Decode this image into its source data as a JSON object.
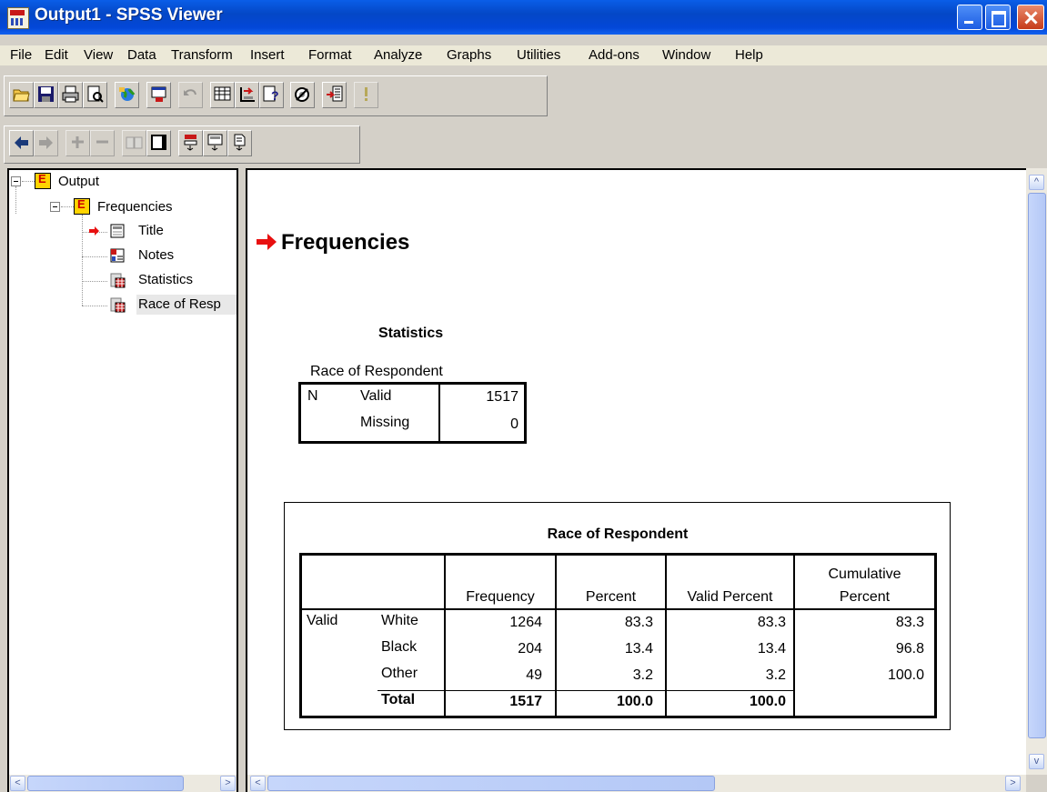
{
  "window": {
    "title": "Output1 - SPSS Viewer"
  },
  "menu": [
    "File",
    "Edit",
    "View",
    "Data",
    "Transform",
    "Insert",
    "Format",
    "Analyze",
    "Graphs",
    "Utilities",
    "Add-ons",
    "Window",
    "Help"
  ],
  "toolbar1": [
    "open-icon",
    "save-icon",
    "print-icon",
    "print-preview-icon",
    "export-icon",
    "dialog-recall-icon",
    "undo-icon",
    "go-to-data-icon",
    "go-to-case-icon",
    "variables-icon",
    "use-sets-icon",
    "designate-window-icon",
    "run-icon"
  ],
  "toolbar2": [
    "promote-icon",
    "demote-icon",
    "expand-icon",
    "collapse-icon",
    "show-icon",
    "hide-icon",
    "insert-heading-icon",
    "insert-title-icon",
    "insert-text-icon"
  ],
  "tree": {
    "root": "Output",
    "child": "Frequencies",
    "items": [
      "Title",
      "Notes",
      "Statistics",
      "Race of Resp"
    ]
  },
  "output": {
    "heading": "Frequencies",
    "statistics": {
      "title": "Statistics",
      "subtitle": "Race of Respondent",
      "n_label": "N",
      "valid_label": "Valid",
      "valid_value": "1517",
      "missing_label": "Missing",
      "missing_value": "0"
    },
    "race_table": {
      "title": "Race of Respondent",
      "headers": [
        "Frequency",
        "Percent",
        "Valid Percent",
        "Cumulative",
        "Percent"
      ],
      "group_label": "Valid",
      "rows": [
        {
          "label": "White",
          "frequency": "1264",
          "percent": "83.3",
          "valid_percent": "83.3",
          "cumulative": "83.3"
        },
        {
          "label": "Black",
          "frequency": "204",
          "percent": "13.4",
          "valid_percent": "13.4",
          "cumulative": "96.8"
        },
        {
          "label": "Other",
          "frequency": "49",
          "percent": "3.2",
          "valid_percent": "3.2",
          "cumulative": "100.0"
        }
      ],
      "total": {
        "label": "Total",
        "frequency": "1517",
        "percent": "100.0",
        "valid_percent": "100.0"
      }
    }
  },
  "colors": {
    "titlebar": "#0447c6",
    "arrow": "#e81010",
    "chrome": "#d4d0c8"
  }
}
